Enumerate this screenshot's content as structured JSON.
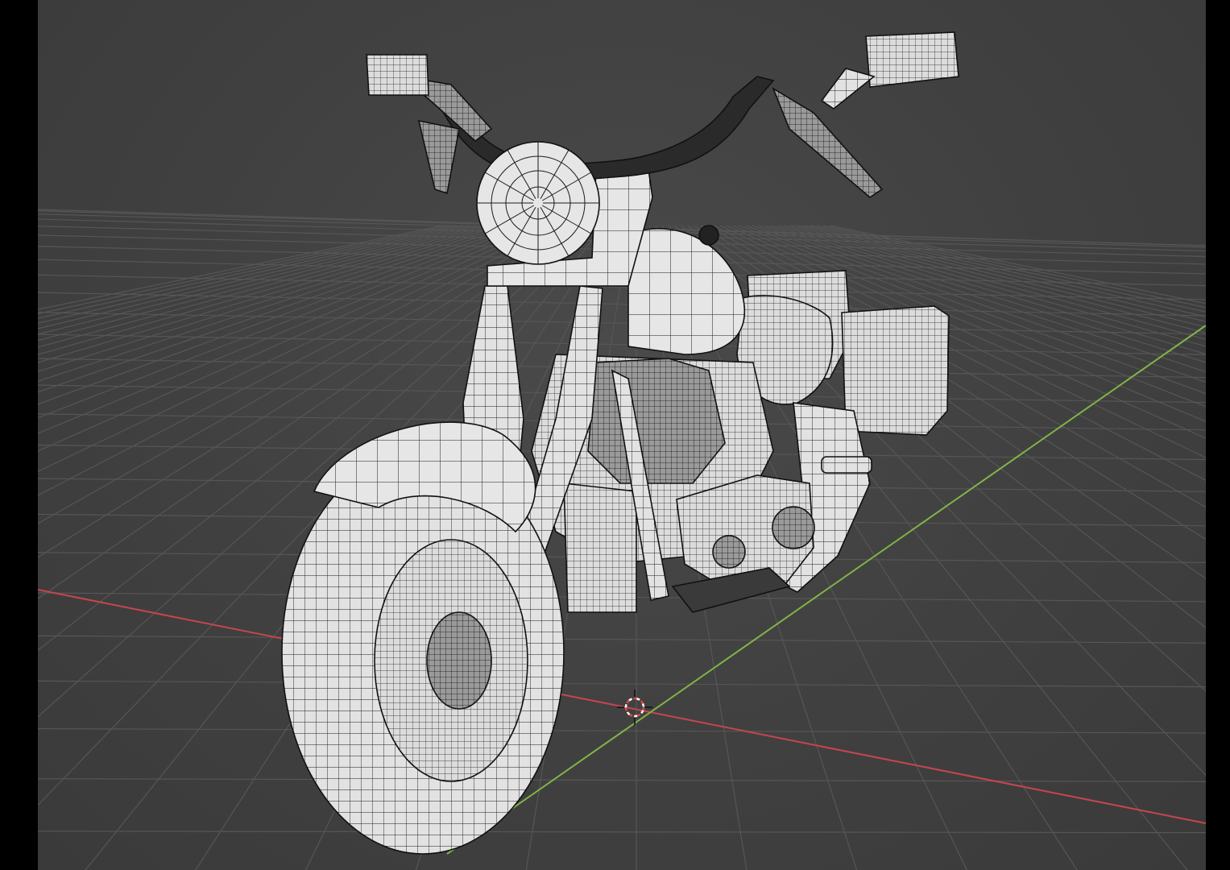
{
  "app": {
    "editor": "3D Viewport",
    "shading": "wireframe-on-solid"
  },
  "viewport": {
    "object": "motorcycle-mesh",
    "background_color": "#414141",
    "grid_color": "#555555",
    "x_axis_color": "#c8454f",
    "y_axis_color": "#7fb547",
    "mesh_color": "#e4e4e4",
    "wire_color": "#111111"
  },
  "icons": {
    "cursor": "3d-cursor-icon"
  }
}
